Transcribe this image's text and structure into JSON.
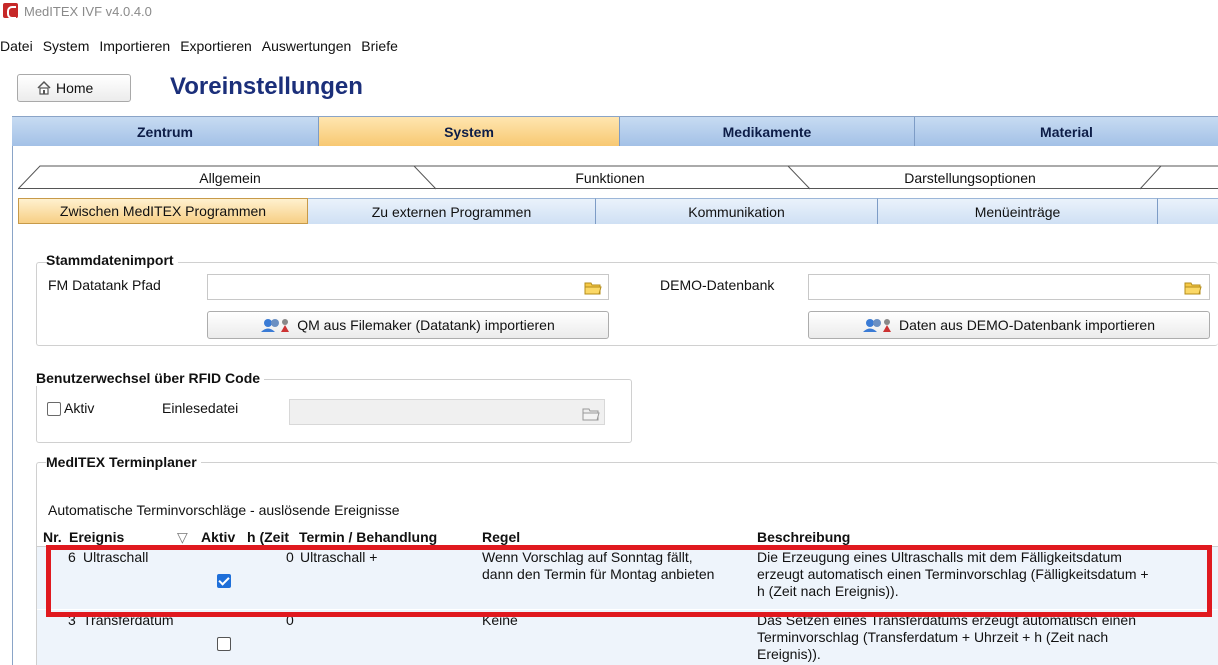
{
  "window": {
    "title": "MedITEX IVF v4.0.4.0"
  },
  "menu": [
    "Datei",
    "System",
    "Importieren",
    "Exportieren",
    "Auswertungen",
    "Briefe"
  ],
  "home_button": "Home",
  "page_title": "Voreinstellungen",
  "main_tabs": [
    "Zentrum",
    "System",
    "Medikamente",
    "Material"
  ],
  "subtabs_row1": [
    "Allgemein",
    "Funktionen",
    "Darstellungsoptionen"
  ],
  "subtabs_row2": [
    "Zwischen MedITEX Programmen",
    "Zu externen Programmen",
    "Kommunikation",
    "Menüeinträge"
  ],
  "stammdaten": {
    "legend": "Stammdatenimport",
    "fm_label": "FM Datatank Pfad",
    "fm_value": "",
    "fm_button": "QM aus Filemaker (Datatank) importieren",
    "demo_label": "DEMO-Datenbank",
    "demo_value": "",
    "demo_button": "Daten aus DEMO-Datenbank importieren"
  },
  "rfid": {
    "legend": "Benutzerwechsel über RFID Code",
    "aktiv_label": "Aktiv",
    "einlese_label": "Einlesedatei",
    "einlese_value": ""
  },
  "terminplaner": {
    "legend": "MedITEX Terminplaner",
    "subtitle": "Automatische Terminvorschläge  - auslösende Ereignisse",
    "columns": [
      "Nr.",
      "Ereignis",
      "Aktiv",
      "h (Zeit",
      "Termin / Behandlung",
      "Regel",
      "Beschreibung"
    ],
    "rows": [
      {
        "nr": "6",
        "ereignis": "Ultraschall",
        "aktiv": true,
        "h": "0",
        "termin": "Ultraschall +",
        "regel_1": "Wenn Vorschlag auf Sonntag fällt,",
        "regel_2": "dann den Termin für Montag anbieten",
        "beschreibung_1": "Die Erzeugung eines Ultraschalls mit dem Fälligkeitsdatum",
        "beschreibung_2": "erzeugt automatisch einen Terminvorschlag (Fälligkeitsdatum +",
        "beschreibung_3": "h (Zeit nach Ereignis))."
      },
      {
        "nr": "3",
        "ereignis": "Transferdatum",
        "aktiv": false,
        "h": "0",
        "termin": "",
        "regel_1": "Keine",
        "regel_2": "",
        "beschreibung_1": "Das Setzen eines Transferdatums erzeugt automatisch einen",
        "beschreibung_2": "Terminvorschlag (Transferdatum + Uhrzeit + h (Zeit nach",
        "beschreibung_3": "Ereignis))."
      }
    ]
  },
  "colors": {
    "accent_blue": "#1b2f7a",
    "highlight_red": "#e0191f",
    "tab_active": "#f7c770",
    "tab_inactive": "#a2c0e6"
  }
}
